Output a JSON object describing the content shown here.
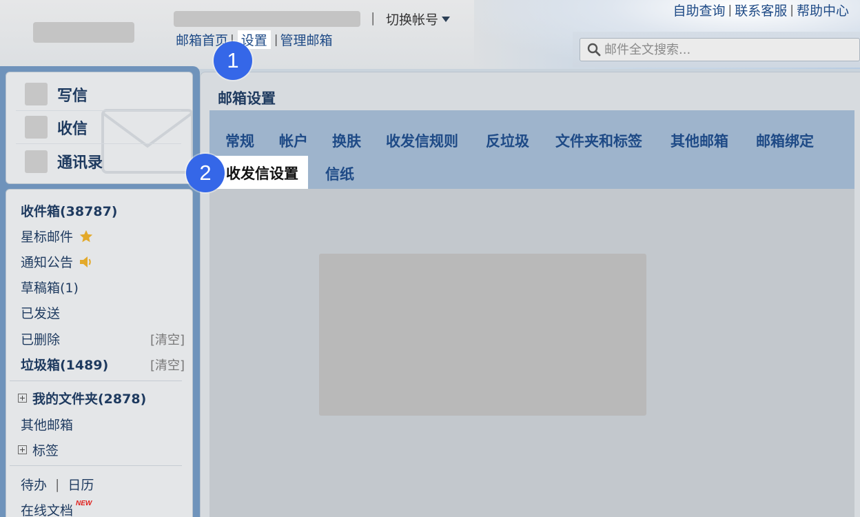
{
  "header": {
    "switch_account": "切换帐号",
    "nav": {
      "home": "邮箱首页",
      "settings": "设置",
      "manage": "管理邮箱",
      "sep": "|"
    },
    "help": {
      "self_service": "自助查询",
      "support": "联系客服",
      "help_center": "帮助中心"
    },
    "search": {
      "placeholder": "邮件全文搜索..."
    }
  },
  "steps": {
    "one": "1",
    "two": "2"
  },
  "sidebar": {
    "quick": {
      "compose": "写信",
      "receive": "收信",
      "contacts": "通讯录"
    },
    "folders": {
      "inbox": "收件箱(38787)",
      "starred": "星标邮件",
      "notices": "通知公告",
      "drafts": "草稿箱(1)",
      "sent": "已发送",
      "deleted": "已删除",
      "spam": "垃圾箱(1489)",
      "clear": "[清空]",
      "my_folders": "我的文件夹(2878)",
      "other_mailboxes": "其他邮箱",
      "tags": "标签",
      "todo": "待办",
      "calendar": "日历",
      "online_docs": "在线文档",
      "new_tag": "NEW"
    }
  },
  "main": {
    "title": "邮箱设置",
    "tabs": {
      "general": "常规",
      "account": "帐户",
      "skin": "换肤",
      "rules": "收发信规则",
      "anti_spam": "反垃圾",
      "folders_tags": "文件夹和标签",
      "other": "其他邮箱",
      "binding": "邮箱绑定",
      "send_receive": "收发信设置",
      "stationery": "信纸"
    },
    "active_tab": "收发信设置"
  },
  "colors": {
    "badge": "#3567e8",
    "link": "#1e4a86",
    "tabbar": "#9eb4cc",
    "frame": "#6f93bb",
    "star": "#e3a92a"
  },
  "icons": {
    "search": "search-icon",
    "star": "star-icon",
    "speaker": "speaker-icon",
    "caret": "caret-down-icon",
    "expand": "plus-box-icon"
  }
}
